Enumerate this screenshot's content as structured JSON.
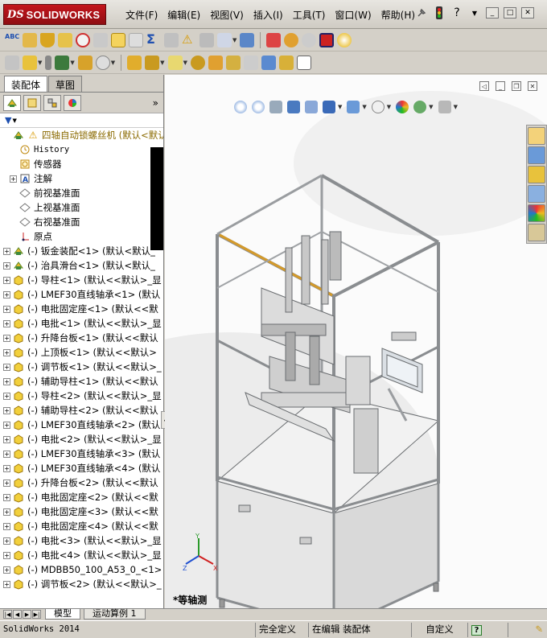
{
  "app": {
    "logo_ds": "DS",
    "logo_name": "SOLIDWORKS"
  },
  "menus": [
    "文件(F)",
    "编辑(E)",
    "视图(V)",
    "插入(I)",
    "工具(T)",
    "窗口(W)",
    "帮助(H)"
  ],
  "panel": {
    "tabs": [
      "装配体",
      "草图"
    ],
    "root_label": "四轴自动锁螺丝机  (默认<默认_",
    "fixed_items": [
      {
        "label": "History",
        "icon": "history-icon",
        "mono": true
      },
      {
        "label": "传感器",
        "icon": "sensor-icon"
      },
      {
        "label": "注解",
        "icon": "annotation-icon",
        "expandable": true
      },
      {
        "label": "前视基准面",
        "icon": "plane-icon"
      },
      {
        "label": "上视基准面",
        "icon": "plane-icon"
      },
      {
        "label": "右视基准面",
        "icon": "plane-icon"
      },
      {
        "label": "原点",
        "icon": "origin-icon"
      }
    ],
    "components": [
      {
        "label": "(-) 钣金装配<1> (默认<默认_",
        "type": "assembly"
      },
      {
        "label": "(-) 治具滑台<1> (默认<默认_",
        "type": "assembly"
      },
      {
        "label": "(-) 导柱<1> (默认<<默认>_显",
        "type": "part"
      },
      {
        "label": "(-) LMEF30直线轴承<1> (默认",
        "type": "part"
      },
      {
        "label": "(-) 电批固定座<1> (默认<<默",
        "type": "part"
      },
      {
        "label": "(-) 电批<1> (默认<<默认>_显",
        "type": "part"
      },
      {
        "label": "(-) 升降台板<1> (默认<<默认",
        "type": "part"
      },
      {
        "label": "(-) 上顶板<1> (默认<<默认>",
        "type": "part"
      },
      {
        "label": "(-) 调节板<1> (默认<<默认>_",
        "type": "part"
      },
      {
        "label": "(-) 辅助导柱<1> (默认<<默认",
        "type": "part"
      },
      {
        "label": "(-) 导柱<2> (默认<<默认>_显",
        "type": "part"
      },
      {
        "label": "(-) 辅助导柱<2> (默认<<默认",
        "type": "part"
      },
      {
        "label": "(-) LMEF30直线轴承<2> (默认",
        "type": "part"
      },
      {
        "label": "(-) 电批<2> (默认<<默认>_显",
        "type": "part"
      },
      {
        "label": "(-) LMEF30直线轴承<3> (默认",
        "type": "part"
      },
      {
        "label": "(-) LMEF30直线轴承<4> (默认",
        "type": "part"
      },
      {
        "label": "(-) 升降台板<2> (默认<<默认",
        "type": "part"
      },
      {
        "label": "(-) 电批固定座<2> (默认<<默",
        "type": "part"
      },
      {
        "label": "(-) 电批固定座<3> (默认<<默",
        "type": "part"
      },
      {
        "label": "(-) 电批固定座<4> (默认<<默",
        "type": "part"
      },
      {
        "label": "(-) 电批<3> (默认<<默认>_显",
        "type": "part"
      },
      {
        "label": "(-) 电批<4> (默认<<默认>_显",
        "type": "part"
      },
      {
        "label": "(-) MDBB50_100_A53_0_<1> (",
        "type": "part"
      },
      {
        "label": "(-) 调节板<2> (默认<<默认>_",
        "type": "part"
      },
      {
        "label": "(-) 调节板<3> (默认<<默认>_",
        "type": "part"
      }
    ]
  },
  "viewport": {
    "view_name": "*等轴测"
  },
  "bottom_tabs": [
    "模型",
    "运动算例 1"
  ],
  "status": {
    "app_version": "SolidWorks 2014",
    "definition": "完全定义",
    "mode": "在编辑 装配体",
    "units": "自定义",
    "help": "?"
  },
  "colors": {
    "frame": "#8a8d90",
    "highlight": "#d49a2a",
    "panel_fill": "#e8e8e8",
    "root_text": "#8a6a00"
  }
}
